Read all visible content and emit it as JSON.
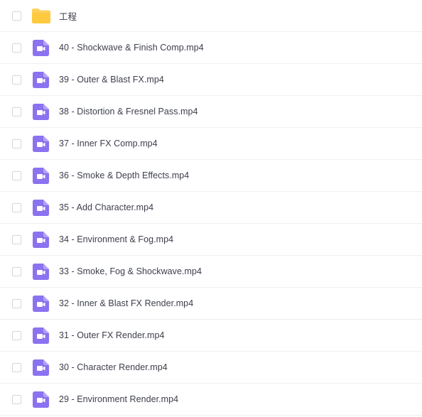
{
  "colors": {
    "video_icon": "#8a72f0",
    "folder_icon": "#ffd05c",
    "text": "#3b3f4a",
    "row_divider": "#eeeff2",
    "checkbox_border": "#d3d6dc"
  },
  "file_list": {
    "items": [
      {
        "name": "工程",
        "type": "folder",
        "icon": "folder-icon"
      },
      {
        "name": "40 - Shockwave & Finish Comp.mp4",
        "type": "video",
        "icon": "video-file-icon"
      },
      {
        "name": "39 - Outer & Blast FX.mp4",
        "type": "video",
        "icon": "video-file-icon"
      },
      {
        "name": "38 - Distortion & Fresnel Pass.mp4",
        "type": "video",
        "icon": "video-file-icon"
      },
      {
        "name": "37 - Inner FX Comp.mp4",
        "type": "video",
        "icon": "video-file-icon"
      },
      {
        "name": "36 - Smoke & Depth Effects.mp4",
        "type": "video",
        "icon": "video-file-icon"
      },
      {
        "name": "35 - Add Character.mp4",
        "type": "video",
        "icon": "video-file-icon"
      },
      {
        "name": "34 - Environment & Fog.mp4",
        "type": "video",
        "icon": "video-file-icon"
      },
      {
        "name": "33 - Smoke, Fog & Shockwave.mp4",
        "type": "video",
        "icon": "video-file-icon"
      },
      {
        "name": "32 - Inner & Blast FX Render.mp4",
        "type": "video",
        "icon": "video-file-icon"
      },
      {
        "name": "31 - Outer FX Render.mp4",
        "type": "video",
        "icon": "video-file-icon"
      },
      {
        "name": "30 - Character Render.mp4",
        "type": "video",
        "icon": "video-file-icon"
      },
      {
        "name": "29 - Environment Render.mp4",
        "type": "video",
        "icon": "video-file-icon"
      }
    ]
  }
}
